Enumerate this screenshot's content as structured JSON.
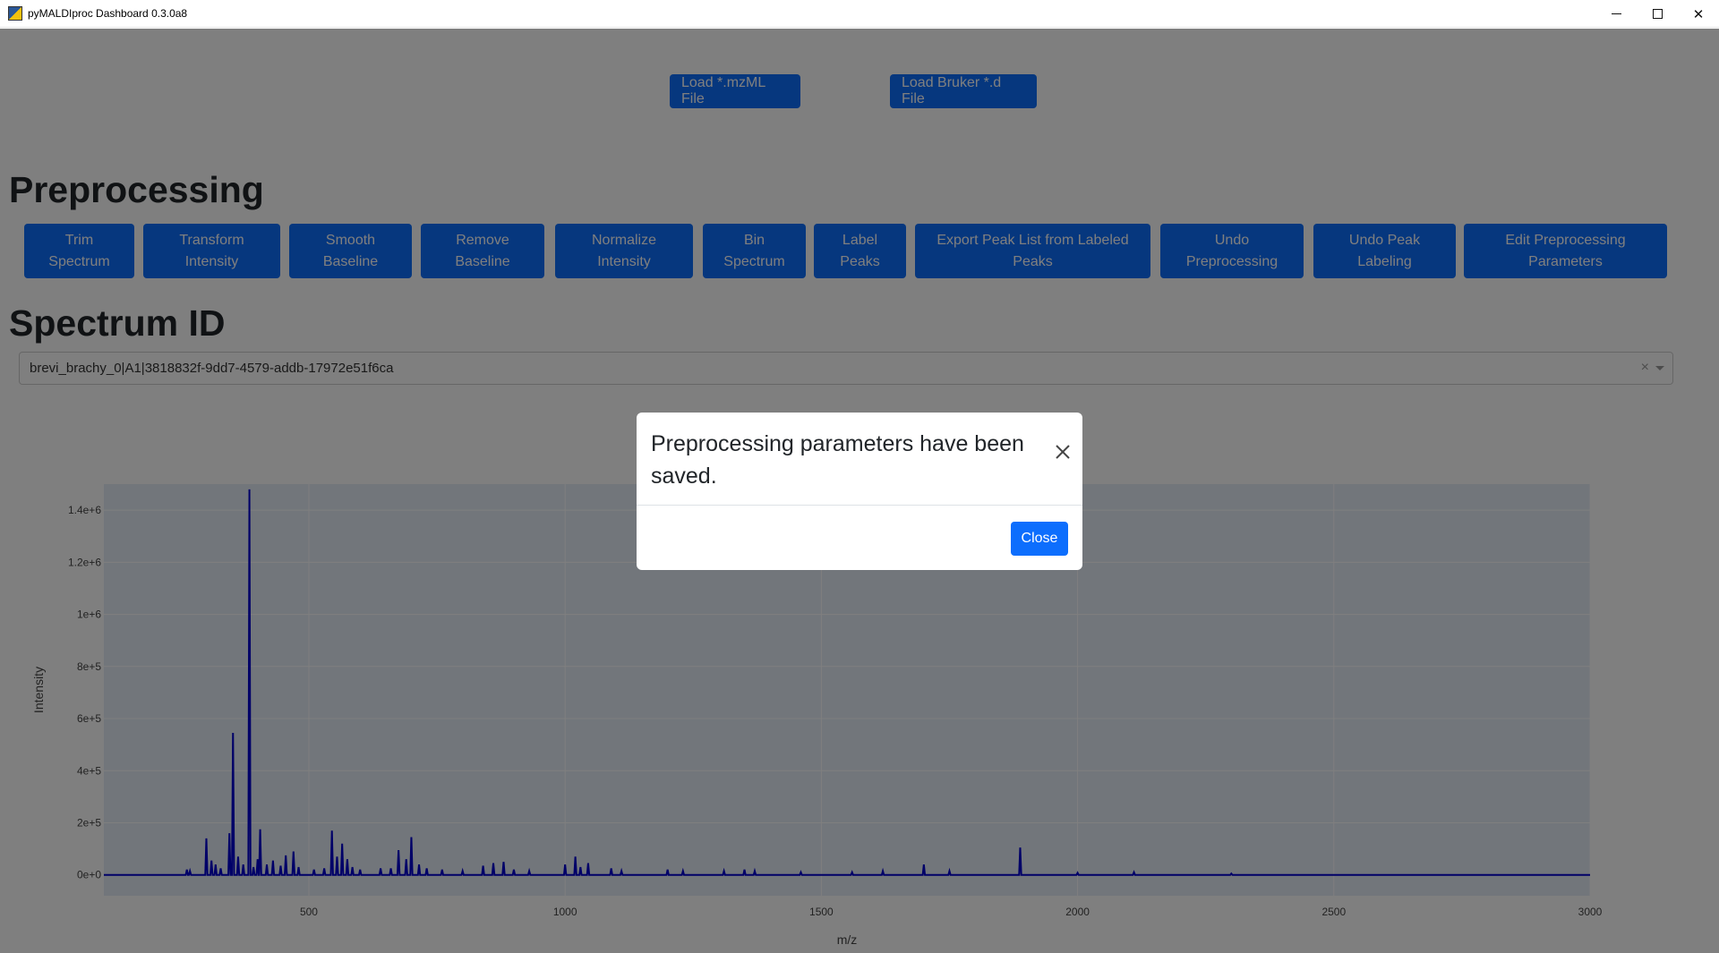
{
  "window": {
    "title": "pyMALDIproc Dashboard 0.3.0a8"
  },
  "load_buttons": {
    "mzml": "Load *.mzML File",
    "bruker": "Load Bruker *.d File"
  },
  "headings": {
    "preprocessing": "Preprocessing",
    "spectrum_id": "Spectrum ID"
  },
  "preprocessing_buttons": [
    {
      "line1": "Trim",
      "line2": "Spectrum"
    },
    {
      "line1": "Transform",
      "line2": "Intensity"
    },
    {
      "line1": "Smooth",
      "line2": "Baseline"
    },
    {
      "line1": "Remove",
      "line2": "Baseline"
    },
    {
      "line1": "Normalize",
      "line2": "Intensity"
    },
    {
      "line1": "Bin",
      "line2": "Spectrum"
    },
    {
      "line1": "Label",
      "line2": "Peaks"
    },
    {
      "line1": "Export Peak List from Labeled",
      "line2": "Peaks"
    },
    {
      "line1": "Undo",
      "line2": "Preprocessing"
    },
    {
      "line1": "Undo Peak",
      "line2": "Labeling"
    },
    {
      "line1": "Edit Preprocessing",
      "line2": "Parameters"
    }
  ],
  "spectrum_select": {
    "value": "brevi_brachy_0|A1|3818832f-9dd7-4579-addb-17972e51f6ca",
    "clear": "×"
  },
  "modal": {
    "title": "Preprocessing parameters have been saved.",
    "close_label": "Close"
  },
  "colors": {
    "primary": "#0d6efd",
    "trace": "#0000d1",
    "plot_bg": "#e5ecf6"
  },
  "chart_data": {
    "type": "line",
    "xlabel": "m/z",
    "ylabel": "Intensity",
    "xlim": [
      100,
      3000
    ],
    "ylim": [
      -80000,
      1500000
    ],
    "x_ticks": [
      500,
      1000,
      1500,
      2000,
      2500,
      3000
    ],
    "y_ticks": [
      {
        "value": 0,
        "label": "0e+0"
      },
      {
        "value": 200000,
        "label": "2e+5"
      },
      {
        "value": 400000,
        "label": "4e+5"
      },
      {
        "value": 600000,
        "label": "6e+5"
      },
      {
        "value": 800000,
        "label": "8e+5"
      },
      {
        "value": 1000000,
        "label": "1e+6"
      },
      {
        "value": 1200000,
        "label": "1.2e+6"
      },
      {
        "value": 1400000,
        "label": "1.4e+6"
      }
    ],
    "grid": true,
    "peaks": [
      [
        262,
        20000
      ],
      [
        268,
        15000
      ],
      [
        300,
        140000
      ],
      [
        310,
        55000
      ],
      [
        318,
        40000
      ],
      [
        328,
        25000
      ],
      [
        345,
        160000
      ],
      [
        352,
        545000
      ],
      [
        362,
        70000
      ],
      [
        372,
        40000
      ],
      [
        384,
        1480000
      ],
      [
        392,
        30000
      ],
      [
        400,
        60000
      ],
      [
        405,
        175000
      ],
      [
        418,
        40000
      ],
      [
        430,
        55000
      ],
      [
        445,
        35000
      ],
      [
        455,
        75000
      ],
      [
        470,
        90000
      ],
      [
        480,
        30000
      ],
      [
        510,
        20000
      ],
      [
        530,
        25000
      ],
      [
        545,
        170000
      ],
      [
        555,
        70000
      ],
      [
        565,
        120000
      ],
      [
        575,
        60000
      ],
      [
        585,
        30000
      ],
      [
        600,
        20000
      ],
      [
        640,
        25000
      ],
      [
        660,
        25000
      ],
      [
        675,
        95000
      ],
      [
        690,
        60000
      ],
      [
        700,
        145000
      ],
      [
        715,
        40000
      ],
      [
        730,
        25000
      ],
      [
        760,
        20000
      ],
      [
        800,
        15000
      ],
      [
        840,
        35000
      ],
      [
        860,
        45000
      ],
      [
        880,
        50000
      ],
      [
        900,
        20000
      ],
      [
        930,
        15000
      ],
      [
        1000,
        40000
      ],
      [
        1020,
        70000
      ],
      [
        1030,
        30000
      ],
      [
        1045,
        45000
      ],
      [
        1090,
        25000
      ],
      [
        1110,
        15000
      ],
      [
        1200,
        20000
      ],
      [
        1230,
        15000
      ],
      [
        1310,
        15000
      ],
      [
        1350,
        20000
      ],
      [
        1370,
        15000
      ],
      [
        1460,
        10000
      ],
      [
        1560,
        10000
      ],
      [
        1620,
        15000
      ],
      [
        1700,
        40000
      ],
      [
        1750,
        15000
      ],
      [
        1888,
        105000
      ],
      [
        2000,
        8000
      ],
      [
        2110,
        10000
      ],
      [
        2300,
        5000
      ]
    ]
  }
}
